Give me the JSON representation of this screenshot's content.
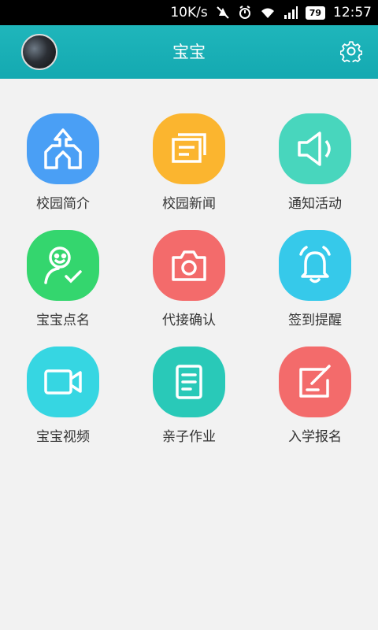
{
  "status_bar": {
    "speed": "10K/s",
    "battery": "79",
    "time": "12:57"
  },
  "header": {
    "title": "宝宝",
    "left_icon": "avatar",
    "right_icon": "gear-icon"
  },
  "grid": {
    "items": [
      {
        "label": "校园简介",
        "icon": "school-icon",
        "color": "#4a9ff5"
      },
      {
        "label": "校园新闻",
        "icon": "news-icon",
        "color": "#fbb52f"
      },
      {
        "label": "通知活动",
        "icon": "speaker-icon",
        "color": "#48d6bd"
      },
      {
        "label": "宝宝点名",
        "icon": "rollcall-icon",
        "color": "#34d66e"
      },
      {
        "label": "代接确认",
        "icon": "camera-icon",
        "color": "#f36b6b"
      },
      {
        "label": "签到提醒",
        "icon": "bell-icon",
        "color": "#36c9ea"
      },
      {
        "label": "宝宝视频",
        "icon": "video-icon",
        "color": "#36d6e2"
      },
      {
        "label": "亲子作业",
        "icon": "homework-icon",
        "color": "#29c9b8"
      },
      {
        "label": "入学报名",
        "icon": "signup-icon",
        "color": "#f36b6b"
      }
    ]
  }
}
